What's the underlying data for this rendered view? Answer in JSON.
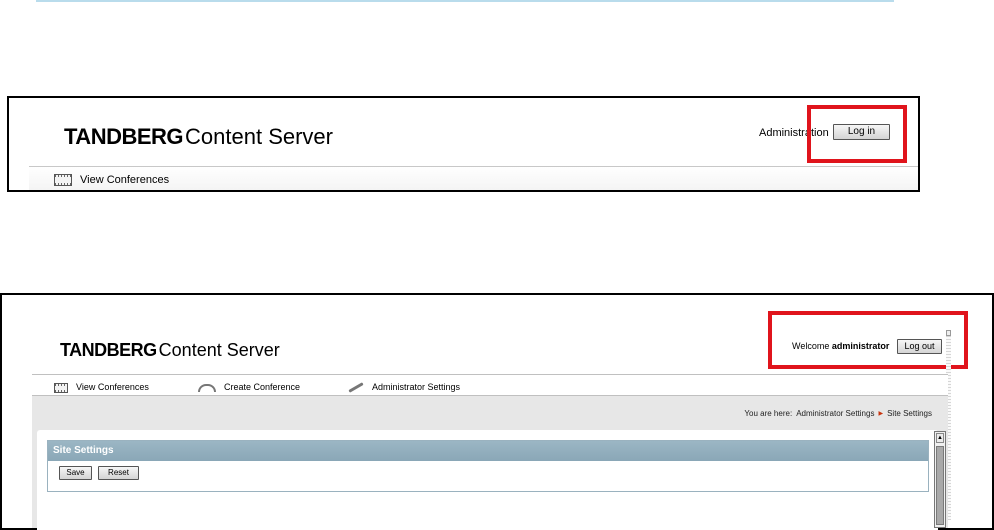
{
  "brand": {
    "name": "TANDBERG",
    "product": "Content Server"
  },
  "screenshot1": {
    "header": {
      "admin_label": "Administration",
      "login_button": "Log in"
    },
    "nav": [
      {
        "label": "View Conferences",
        "icon": "film-icon"
      }
    ],
    "highlight_color": "#e0141c"
  },
  "screenshot2": {
    "header": {
      "welcome_text": "Welcome",
      "username": "administrator",
      "logout_button": "Log out"
    },
    "nav": [
      {
        "label": "View Conferences",
        "icon": "film-icon"
      },
      {
        "label": "Create Conference",
        "icon": "phone-icon"
      },
      {
        "label": "Administrator Settings",
        "icon": "wrench-icon"
      }
    ],
    "breadcrumb": {
      "prefix": "You are here:",
      "items": [
        "Administrator Settings",
        "Site Settings"
      ]
    },
    "panel": {
      "title": "Site Settings",
      "save_button": "Save",
      "reset_button": "Reset"
    },
    "panel_title_color": "#8fadbe",
    "highlight_color": "#e0141c"
  }
}
